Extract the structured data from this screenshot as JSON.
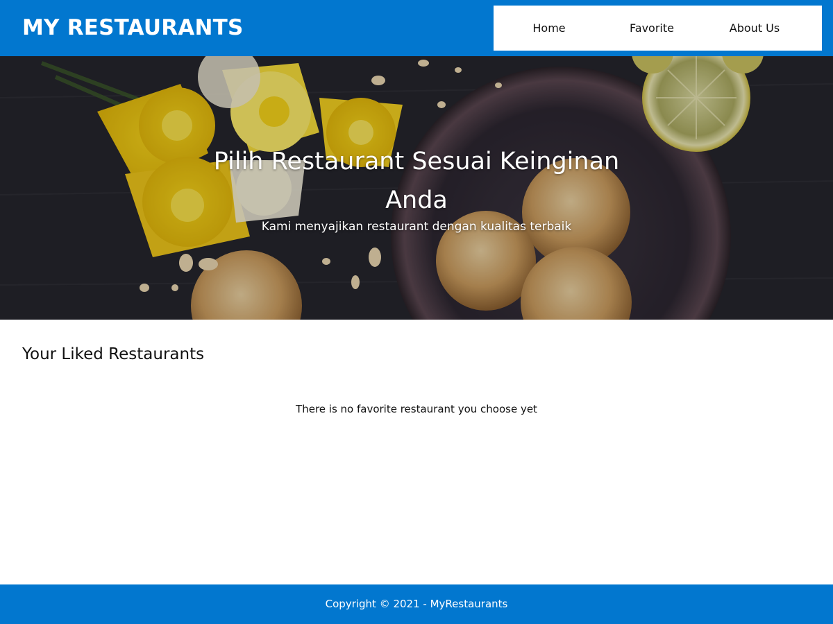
{
  "header": {
    "brand": "MY RESTAURANTS",
    "nav": [
      {
        "label": "Home"
      },
      {
        "label": "Favorite"
      },
      {
        "label": "About Us"
      }
    ]
  },
  "hero": {
    "title": "Pilih Restaurant Sesuai Keinginan Anda",
    "subtitle": "Kami menyajikan restaurant dengan kualitas terbaik"
  },
  "main": {
    "heading": "Your Liked Restaurants",
    "empty_message": "There is no favorite restaurant you choose yet"
  },
  "footer": {
    "copyright": "Copyright © 2021 - MyRestaurants"
  },
  "colors": {
    "primary": "#0277cf",
    "nav_background": "#ffffff",
    "text": "#111111"
  },
  "icons": {
    "hero_image": "food-flowers-cookies-photo"
  }
}
